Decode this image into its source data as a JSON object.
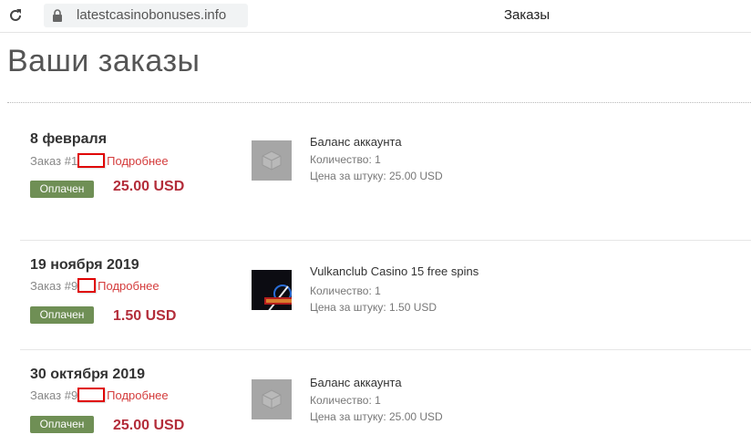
{
  "browser": {
    "url": "latestcasinobonuses.info",
    "tab_title": "Заказы"
  },
  "page": {
    "title": "Ваши заказы"
  },
  "labels": {
    "order_prefix": "Заказ #",
    "details": "Подробнее",
    "quantity_label": "Количество: ",
    "unit_price_label": "Цена за штуку: "
  },
  "orders": [
    {
      "date": "8 февраля",
      "order_prefix": "Заказ #1",
      "details": "Подробнее",
      "status": "Оплачен",
      "total": "25.00 USD",
      "product": "Баланс аккаунта",
      "quantity": "Количество: 1",
      "unit_price": "Цена за штуку: 25.00 USD",
      "thumbnail": "placeholder-box-icon"
    },
    {
      "date": "19 ноября 2019",
      "order_prefix": "Заказ #9",
      "details": "Подробнее",
      "status": "Оплачен",
      "total": "1.50 USD",
      "product": "Vulkanclub Casino 15 free spins",
      "quantity": "Количество: 1",
      "unit_price": "Цена за штуку: 1.50 USD",
      "thumbnail": "casino-logo-image"
    },
    {
      "date": "30 октября 2019",
      "order_prefix": "Заказ #9",
      "details": "Подробнее",
      "status": "Оплачен",
      "total": "25.00 USD",
      "product": "Баланс аккаунта",
      "quantity": "Количество: 1",
      "unit_price": "Цена за штуку: 25.00 USD",
      "thumbnail": "placeholder-box-icon"
    }
  ],
  "colors": {
    "paid_badge": "#6f8f55",
    "price": "#b32d3a",
    "details_link": "#d43c3c",
    "redaction_box": "#e00000"
  }
}
